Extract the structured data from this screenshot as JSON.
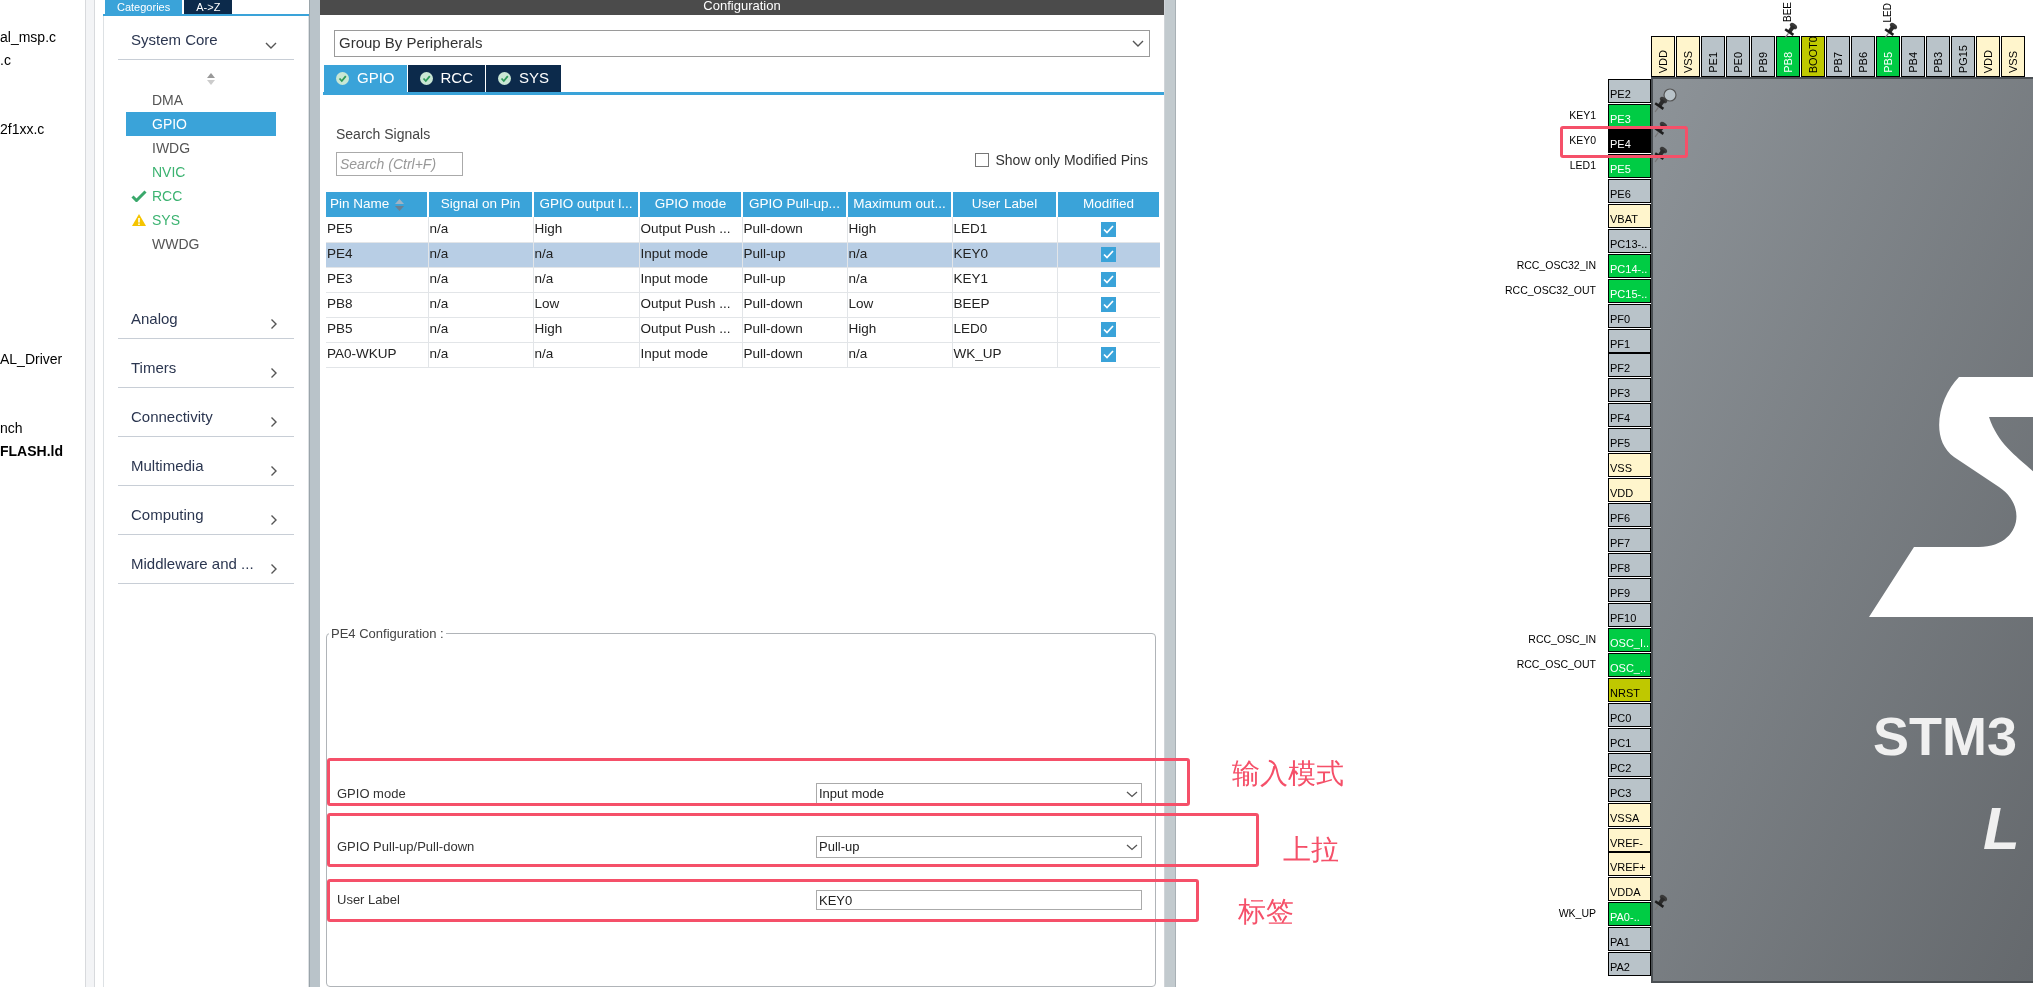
{
  "file_tree": {
    "items": [
      {
        "label": "al_msp.c",
        "bold": false
      },
      {
        "label": ".c",
        "bold": false
      },
      {
        "label": "2f1xx.c",
        "bold": false
      },
      {
        "label": "AL_Driver",
        "bold": false
      },
      {
        "label": "nch",
        "bold": false
      },
      {
        "label": "FLASH.ld",
        "bold": true
      }
    ]
  },
  "categories": {
    "tabs": [
      {
        "label": "Categories",
        "selected": true
      },
      {
        "label": "A->Z",
        "selected": false
      }
    ],
    "groups": [
      {
        "label": "System Core",
        "expanded": true,
        "items": [
          {
            "label": "DMA",
            "selected": false,
            "configured": false,
            "kind": "plain"
          },
          {
            "label": "GPIO",
            "selected": true,
            "configured": false,
            "kind": "plain"
          },
          {
            "label": "IWDG",
            "selected": false,
            "configured": false,
            "kind": "plain"
          },
          {
            "label": "NVIC",
            "selected": false,
            "configured": true,
            "kind": "plain"
          },
          {
            "label": "RCC",
            "selected": false,
            "configured": true,
            "kind": "check"
          },
          {
            "label": "SYS",
            "selected": false,
            "configured": true,
            "kind": "warning"
          },
          {
            "label": "WWDG",
            "selected": false,
            "configured": false,
            "kind": "plain"
          }
        ]
      },
      {
        "label": "Analog",
        "expanded": false
      },
      {
        "label": "Timers",
        "expanded": false
      },
      {
        "label": "Connectivity",
        "expanded": false
      },
      {
        "label": "Multimedia",
        "expanded": false
      },
      {
        "label": "Computing",
        "expanded": false
      },
      {
        "label": "Middleware and ...",
        "expanded": false
      }
    ]
  },
  "configuration": {
    "title": "Configuration",
    "group_by": "Group By Peripherals",
    "tabs": [
      {
        "label": "GPIO",
        "selected": true
      },
      {
        "label": "RCC",
        "selected": false
      },
      {
        "label": "SYS",
        "selected": false
      }
    ],
    "search": {
      "label": "Search Signals",
      "placeholder": "Search (Ctrl+F)"
    },
    "modified_only": {
      "label": "Show only Modified Pins",
      "checked": false
    },
    "table": {
      "columns": [
        "Pin Name",
        "Signal on Pin",
        "GPIO output l...",
        "GPIO mode",
        "GPIO Pull-up...",
        "Maximum out...",
        "User Label",
        "Modified"
      ],
      "rows": [
        {
          "cells": [
            "PE5",
            "n/a",
            "High",
            "Output Push ...",
            "Pull-down",
            "High",
            "LED1"
          ],
          "modified": true,
          "selected": false
        },
        {
          "cells": [
            "PE4",
            "n/a",
            "n/a",
            "Input mode",
            "Pull-up",
            "n/a",
            "KEY0"
          ],
          "modified": true,
          "selected": true
        },
        {
          "cells": [
            "PE3",
            "n/a",
            "n/a",
            "Input mode",
            "Pull-up",
            "n/a",
            "KEY1"
          ],
          "modified": true,
          "selected": false
        },
        {
          "cells": [
            "PB8",
            "n/a",
            "Low",
            "Output Push ...",
            "Pull-down",
            "Low",
            "BEEP"
          ],
          "modified": true,
          "selected": false
        },
        {
          "cells": [
            "PB5",
            "n/a",
            "High",
            "Output Push ...",
            "Pull-down",
            "High",
            "LED0"
          ],
          "modified": true,
          "selected": false
        },
        {
          "cells": [
            "PA0-WKUP",
            "n/a",
            "n/a",
            "Input mode",
            "Pull-down",
            "n/a",
            "WK_UP"
          ],
          "modified": true,
          "selected": false
        }
      ]
    },
    "pin_config": {
      "title": "PE4 Configuration :",
      "fields": [
        {
          "kind": "select",
          "label": "GPIO mode",
          "value": "Input mode"
        },
        {
          "kind": "select",
          "label": "GPIO Pull-up/Pull-down",
          "value": "Pull-up"
        },
        {
          "kind": "text",
          "label": "User Label",
          "value": "KEY0"
        }
      ]
    }
  },
  "annotations": [
    {
      "text": "输入模式"
    },
    {
      "text": "上拉"
    },
    {
      "text": "标签"
    }
  ],
  "chip": {
    "name": "STM3",
    "package": "L",
    "top_pins": [
      {
        "label": "VDD",
        "kind": "power",
        "selected": false,
        "pinned": false
      },
      {
        "label": "VSS",
        "kind": "power",
        "selected": false,
        "pinned": false
      },
      {
        "label": "PE1",
        "kind": "io",
        "selected": false,
        "pinned": false
      },
      {
        "label": "PE0",
        "kind": "io",
        "selected": false,
        "pinned": false
      },
      {
        "label": "PB9",
        "kind": "io",
        "selected": false,
        "pinned": false
      },
      {
        "label": "PB8",
        "kind": "mapped",
        "selected": false,
        "pinned": true,
        "signal": "BEE"
      },
      {
        "label": "BOOT0",
        "kind": "boot",
        "selected": false,
        "pinned": false
      },
      {
        "label": "PB7",
        "kind": "io",
        "selected": false,
        "pinned": false
      },
      {
        "label": "PB6",
        "kind": "io",
        "selected": false,
        "pinned": false
      },
      {
        "label": "PB5",
        "kind": "mapped",
        "selected": false,
        "pinned": true,
        "signal": "LED"
      },
      {
        "label": "PB4",
        "kind": "io",
        "selected": false,
        "pinned": false
      },
      {
        "label": "PB3",
        "kind": "io",
        "selected": false,
        "pinned": false
      },
      {
        "label": "PG15",
        "kind": "io",
        "selected": false,
        "pinned": false
      },
      {
        "label": "VDD",
        "kind": "power",
        "selected": false,
        "pinned": false
      },
      {
        "label": "VSS",
        "kind": "power",
        "selected": false,
        "pinned": false
      }
    ],
    "left_pins": [
      {
        "label": "PE2",
        "kind": "io",
        "selected": false,
        "pinned": false
      },
      {
        "label": "PE3",
        "kind": "mapped",
        "selected": false,
        "pinned": true,
        "signal": "KEY1"
      },
      {
        "label": "PE4",
        "kind": "mapped",
        "selected": true,
        "pinned": true,
        "signal": "KEY0"
      },
      {
        "label": "PE5",
        "kind": "mapped",
        "selected": false,
        "pinned": true,
        "signal": "LED1"
      },
      {
        "label": "PE6",
        "kind": "io",
        "selected": false,
        "pinned": false
      },
      {
        "label": "VBAT",
        "kind": "power",
        "selected": false,
        "pinned": false
      },
      {
        "label": "PC13-..",
        "kind": "io",
        "selected": false,
        "pinned": false
      },
      {
        "label": "PC14-..",
        "kind": "mapped",
        "selected": false,
        "pinned": false,
        "signal": "RCC_OSC32_IN"
      },
      {
        "label": "PC15-..",
        "kind": "mapped",
        "selected": false,
        "pinned": false,
        "signal": "RCC_OSC32_OUT"
      },
      {
        "label": "PF0",
        "kind": "io",
        "selected": false,
        "pinned": false
      },
      {
        "label": "PF1",
        "kind": "io",
        "selected": false,
        "pinned": false
      },
      {
        "label": "PF2",
        "kind": "io",
        "selected": false,
        "pinned": false
      },
      {
        "label": "PF3",
        "kind": "io",
        "selected": false,
        "pinned": false
      },
      {
        "label": "PF4",
        "kind": "io",
        "selected": false,
        "pinned": false
      },
      {
        "label": "PF5",
        "kind": "io",
        "selected": false,
        "pinned": false
      },
      {
        "label": "VSS",
        "kind": "power",
        "selected": false,
        "pinned": false
      },
      {
        "label": "VDD",
        "kind": "power",
        "selected": false,
        "pinned": false
      },
      {
        "label": "PF6",
        "kind": "io",
        "selected": false,
        "pinned": false
      },
      {
        "label": "PF7",
        "kind": "io",
        "selected": false,
        "pinned": false
      },
      {
        "label": "PF8",
        "kind": "io",
        "selected": false,
        "pinned": false
      },
      {
        "label": "PF9",
        "kind": "io",
        "selected": false,
        "pinned": false
      },
      {
        "label": "PF10",
        "kind": "io",
        "selected": false,
        "pinned": false
      },
      {
        "label": "OSC_I..",
        "kind": "mapped",
        "selected": false,
        "pinned": false,
        "signal": "RCC_OSC_IN"
      },
      {
        "label": "OSC_..",
        "kind": "mapped",
        "selected": false,
        "pinned": false,
        "signal": "RCC_OSC_OUT"
      },
      {
        "label": "NRST",
        "kind": "boot",
        "selected": false,
        "pinned": false
      },
      {
        "label": "PC0",
        "kind": "io",
        "selected": false,
        "pinned": false
      },
      {
        "label": "PC1",
        "kind": "io",
        "selected": false,
        "pinned": false
      },
      {
        "label": "PC2",
        "kind": "io",
        "selected": false,
        "pinned": false
      },
      {
        "label": "PC3",
        "kind": "io",
        "selected": false,
        "pinned": false
      },
      {
        "label": "VSSA",
        "kind": "power",
        "selected": false,
        "pinned": false
      },
      {
        "label": "VREF-",
        "kind": "power",
        "selected": false,
        "pinned": false
      },
      {
        "label": "VREF+",
        "kind": "power",
        "selected": false,
        "pinned": false
      },
      {
        "label": "VDDA",
        "kind": "power",
        "selected": false,
        "pinned": false
      },
      {
        "label": "PA0-..",
        "kind": "mapped",
        "selected": false,
        "pinned": true,
        "signal": "WK_UP"
      },
      {
        "label": "PA1",
        "kind": "io",
        "selected": false,
        "pinned": false
      },
      {
        "label": "PA2",
        "kind": "io",
        "selected": false,
        "pinned": false
      }
    ]
  }
}
